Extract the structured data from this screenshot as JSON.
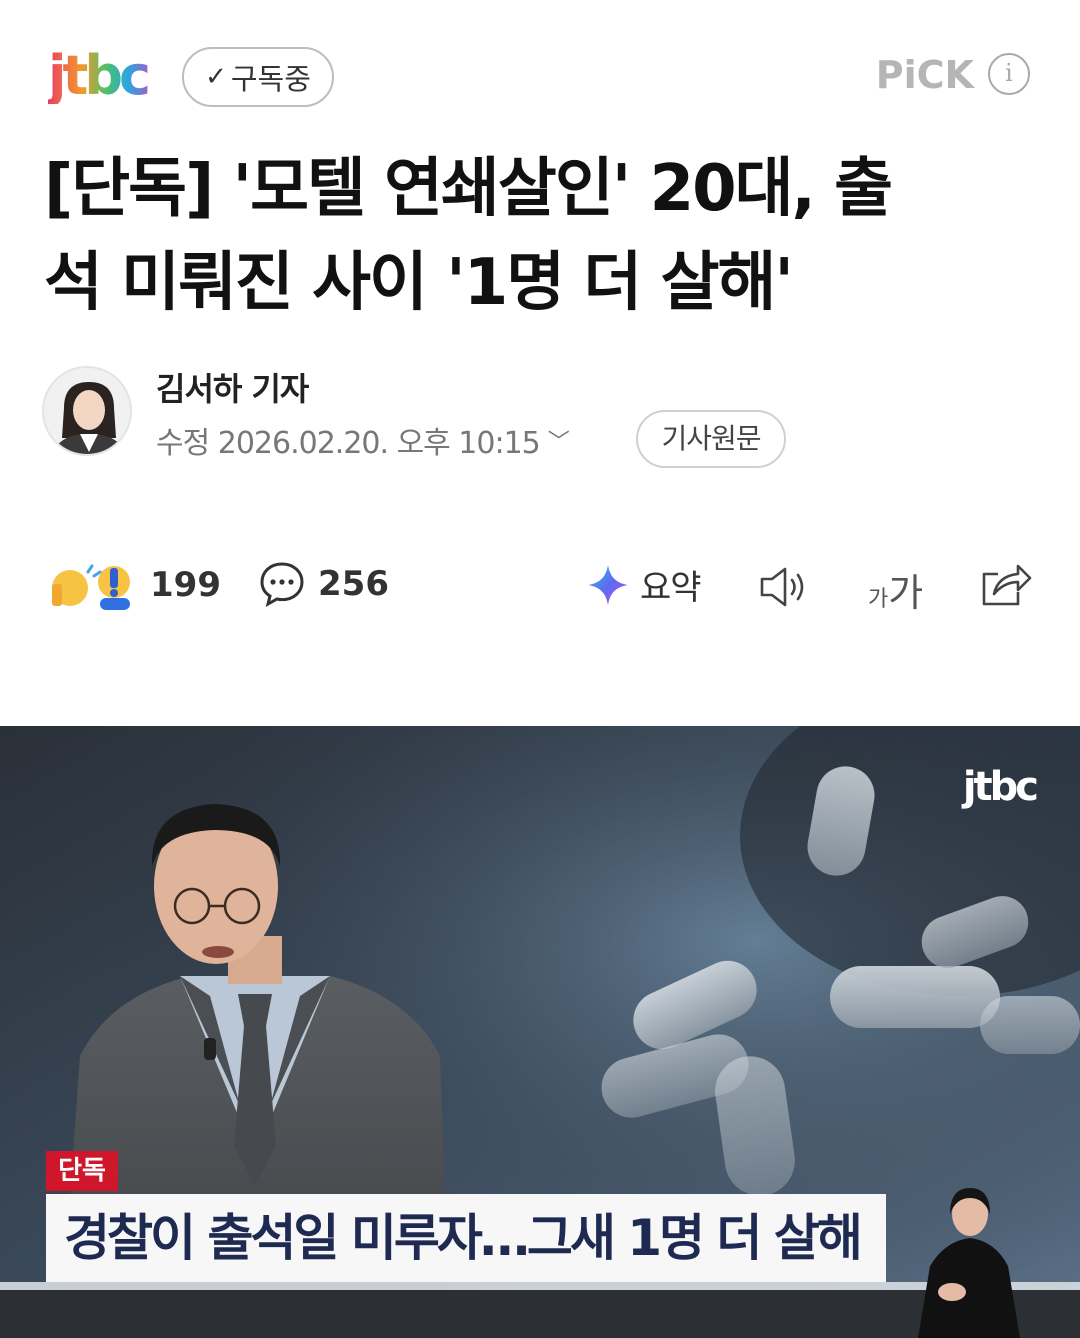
{
  "header": {
    "logo_alt": "jtbc",
    "subscribe_label": "구독중",
    "pick_label": "PiCK",
    "info_icon": "info-icon"
  },
  "article": {
    "title_line1": "[단독] '모텔 연쇄살인' 20대, 출",
    "title_line2": "석 미뤄진 사이 '1명 더 살해'",
    "reporter": "김서하 기자",
    "dateline": "수정 2026.02.20. 오후 10:15",
    "original_button": "기사원문"
  },
  "actions": {
    "reaction_count": "199",
    "comment_count": "256",
    "summary_label": "요약",
    "font_size_label_small": "가",
    "font_size_label_large": "가",
    "icons": [
      "reaction-emoji-icon",
      "comment-icon",
      "ai-summary-icon",
      "speaker-icon",
      "font-size-icon",
      "share-icon"
    ]
  },
  "video": {
    "watermark": "jtbc",
    "badge": "단독",
    "caption": "경찰이 출석일 미루자…그새 1명 더 살해"
  },
  "colors": {
    "badge_red": "#d0162a",
    "caption_text": "#1f2a52",
    "pick_gray": "#b5b5b5"
  }
}
